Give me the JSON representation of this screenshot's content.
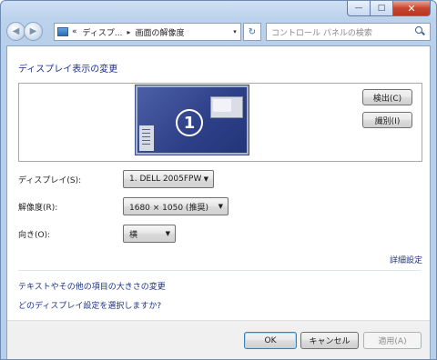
{
  "window": {
    "caption": {
      "minimize": "—",
      "maximize": "□",
      "close": "✕"
    }
  },
  "nav": {
    "back_icon": "◀",
    "forward_icon": "▶",
    "breadcrumb_prefix": "«",
    "breadcrumb": [
      "ディスプ...",
      "画面の解像度"
    ],
    "breadcrumb_separator": "▸",
    "dropdown_icon": "▾",
    "refresh_icon": "↻",
    "search_placeholder": "コントロール パネルの検索"
  },
  "main": {
    "heading": "ディスプレイ表示の変更",
    "monitor_number": "1",
    "detect_button": "検出(C)",
    "identify_button": "識別(I)"
  },
  "settings": {
    "display_label": "ディスプレイ(S):",
    "display_value": "1. DELL 2005FPW",
    "resolution_label": "解像度(R):",
    "resolution_value": "1680 × 1050 (推奨)",
    "orientation_label": "向き(O):",
    "orientation_value": "横",
    "dropdown_arrow": "▼"
  },
  "links": {
    "advanced": "詳細設定",
    "text_size": "テキストやその他の項目の大きさの変更",
    "which_setting": "どのディスプレイ設定を選択しますか?"
  },
  "footer": {
    "ok": "OK",
    "cancel": "キャンセル",
    "apply": "適用(A)"
  },
  "colors": {
    "link": "#1e3287",
    "monitor": "#2d3f86",
    "chrome": "#b7cfea"
  }
}
